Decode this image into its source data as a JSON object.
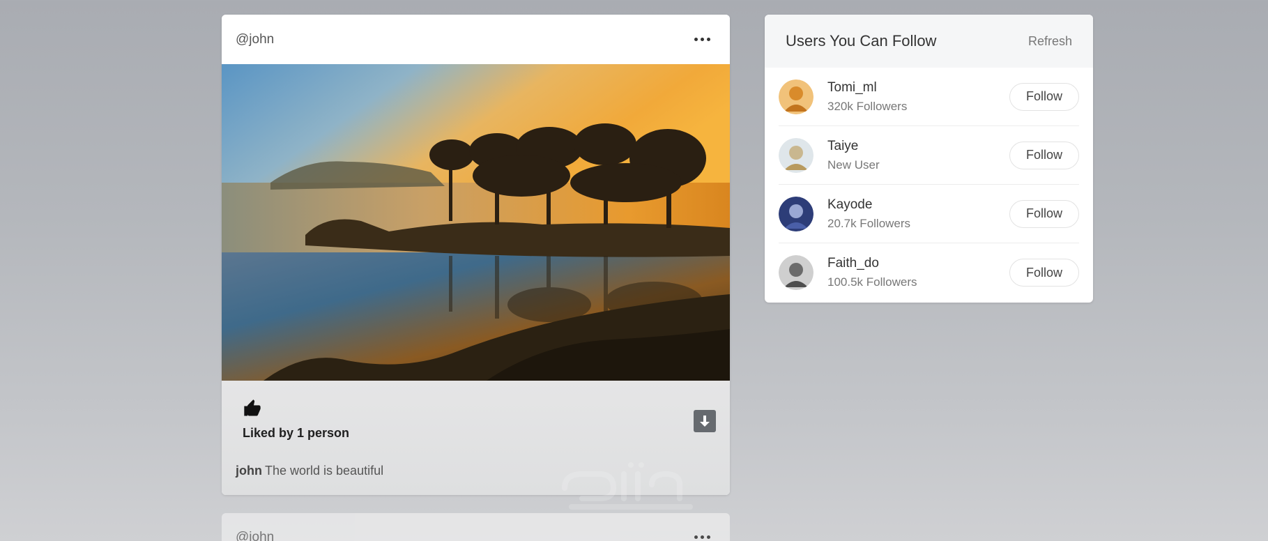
{
  "post": {
    "username": "@john",
    "more_icon": "more-horizontal-icon",
    "like_icon": "thumbs-up-icon",
    "liked_by": "Liked by 1 person",
    "download_icon": "download-icon",
    "caption_user": "john",
    "caption_text": "The world is beautiful"
  },
  "next_post": {
    "username": "@john"
  },
  "suggestions": {
    "title": "Users You Can Follow",
    "refresh_label": "Refresh",
    "users": [
      {
        "name": "Tomi_ml",
        "subtitle": "320k Followers",
        "button": "Follow",
        "avatar_color": "#d98b2b"
      },
      {
        "name": "Taiye",
        "subtitle": "New User",
        "button": "Follow",
        "avatar_color": "#c9b78f"
      },
      {
        "name": "Kayode",
        "subtitle": "20.7k Followers",
        "button": "Follow",
        "avatar_color": "#4a5fa8"
      },
      {
        "name": "Faith_do",
        "subtitle": "100.5k Followers",
        "button": "Follow",
        "avatar_color": "#6b6b6b"
      }
    ]
  }
}
